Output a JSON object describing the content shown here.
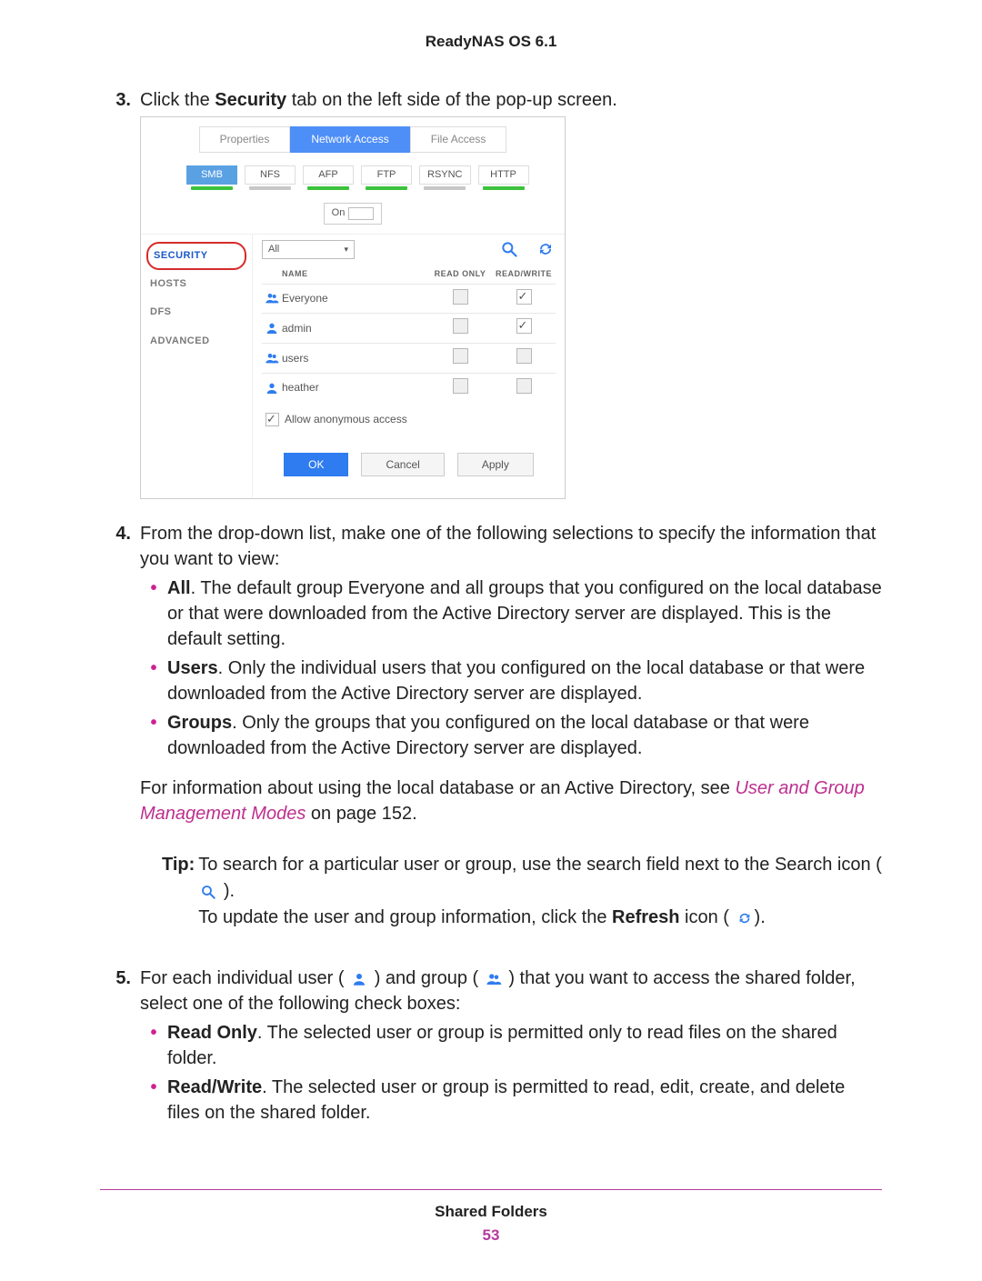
{
  "header": "ReadyNAS OS 6.1",
  "footer_title": "Shared Folders",
  "page_number": "53",
  "step3": {
    "num": "3.",
    "text_pre": "Click the ",
    "text_bold": "Security",
    "text_post": " tab on the left side of the pop-up screen."
  },
  "shot": {
    "tabs": {
      "properties": "Properties",
      "network": "Network Access",
      "file": "File Access"
    },
    "protocols": {
      "smb": "SMB",
      "nfs": "NFS",
      "afp": "AFP",
      "ftp": "FTP",
      "rsync": "RSYNC",
      "http": "HTTP"
    },
    "toggle": "On",
    "sidebar": {
      "security": "SECURITY",
      "hosts": "HOSTS",
      "dfs": "DFS",
      "advanced": "ADVANCED"
    },
    "dropdown": "All",
    "columns": {
      "name": "NAME",
      "ro": "READ ONLY",
      "rw": "READ/WRITE"
    },
    "rows": [
      {
        "name": "Everyone",
        "type": "group",
        "rw_checked": true
      },
      {
        "name": "admin",
        "type": "user",
        "rw_checked": true
      },
      {
        "name": "users",
        "type": "group",
        "rw_checked": false
      },
      {
        "name": "heather",
        "type": "user",
        "rw_checked": false
      }
    ],
    "anon": "Allow anonymous access",
    "buttons": {
      "ok": "OK",
      "cancel": "Cancel",
      "apply": "Apply"
    }
  },
  "step4": {
    "num": "4.",
    "text": "From the drop-down list, make one of the following selections to specify the information that you want to view:",
    "bullets": {
      "all": {
        "label": "All",
        "text": ". The default group Everyone and all groups that you configured on the local database or that were downloaded from the Active Directory server are displayed. This is the default setting."
      },
      "users": {
        "label": "Users",
        "text": ". Only the individual users that you configured on the local database or that were downloaded from the Active Directory server are displayed."
      },
      "groups": {
        "label": "Groups",
        "text": ". Only the groups that you configured on the local database or that were downloaded from the Active Directory server are displayed."
      }
    },
    "after_a": "For information about using the local database or an Active Directory, see ",
    "after_link": "User and Group Management Modes",
    "after_b": " on page 152."
  },
  "tip": {
    "label": "Tip:",
    "line1a": "To search for a particular user or group, use the search field next to the Search icon (",
    "line1b": ").",
    "line2a": "To update the user and group information, click the ",
    "line2bold": "Refresh",
    "line2b": " icon (",
    "line2c": ")."
  },
  "step5": {
    "num": "5.",
    "text_a": "For each individual user (",
    "text_b": ") and group (",
    "text_c": ") that you want to access the shared folder, select one of the following check boxes:",
    "bullets": {
      "ro": {
        "label": "Read Only",
        "text": ". The selected user or group is permitted only to read files on the shared folder."
      },
      "rw": {
        "label": "Read/Write",
        "text": ". The selected user or group is permitted to read, edit, create, and delete files on the shared folder."
      }
    }
  }
}
